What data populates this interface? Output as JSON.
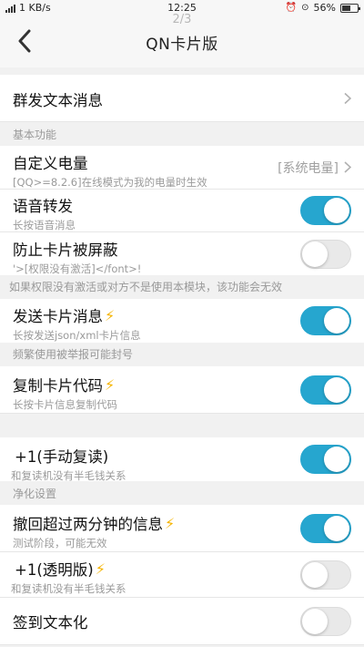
{
  "status_bar": {
    "network_speed": "1 KB/s",
    "time": "12:25",
    "battery_percent": "56%",
    "battery_level": 0.56
  },
  "nav": {
    "title": "QN卡片版",
    "page_indicator": "2/3"
  },
  "rows": {
    "group_text": {
      "label": "群发文本消息"
    },
    "section_basic": "基本功能",
    "custom_power": {
      "label": "自定义电量",
      "sub": "[QQ>=8.2.6]在线模式为我的电量时生效",
      "value": "[系统电量]"
    },
    "voice_forward": {
      "label": "语音转发",
      "sub": "长按语音消息",
      "on": true
    },
    "block_card": {
      "label": "防止卡片被屏蔽",
      "sub": "'>[权限没有激活]</font>!",
      "on": false
    },
    "block_note": "如果权限没有激活或对方不是使用本模块，该功能会无效",
    "send_card": {
      "label": "发送卡片消息",
      "sub": "长按发送json/xml卡片信息",
      "on": true
    },
    "send_note": "频繁使用被举报可能封号",
    "copy_card": {
      "label": "复制卡片代码",
      "sub": "长按卡片信息复制代码",
      "on": true
    },
    "plus_one_manual": {
      "label": "+1(手动复读)",
      "sub": "和复读机没有半毛钱关系",
      "on": true
    },
    "section_clean": "净化设置",
    "recall_over": {
      "label": "撤回超过两分钟的信息",
      "sub": "测试阶段，可能无效",
      "on": true
    },
    "plus_one_transparent": {
      "label": "+1(透明版)",
      "sub": "和复读机没有半毛钱关系",
      "on": false
    },
    "checkin_text": {
      "label": "签到文本化",
      "on": false
    }
  },
  "colors": {
    "toggle_on": "#26a6cf",
    "bolt": "#f5b400"
  }
}
